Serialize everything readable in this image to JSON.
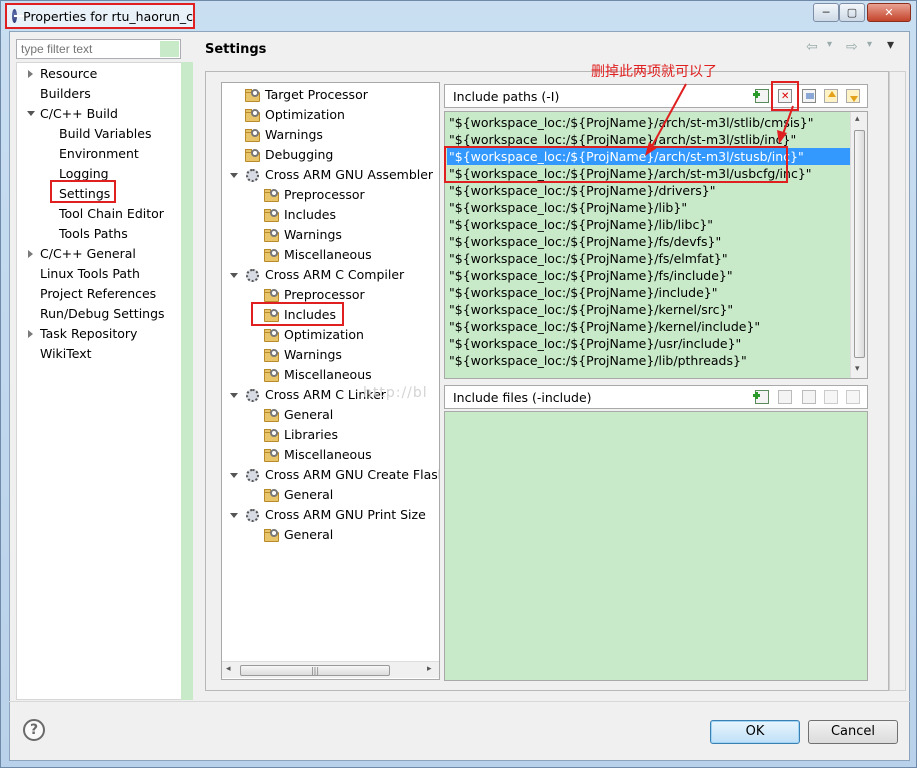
{
  "window": {
    "title": "Properties for rtu_haorun_c",
    "minimize": "─",
    "maximize": "▢",
    "close": "✕"
  },
  "sidebar": {
    "filter_placeholder": "type filter text",
    "items": [
      {
        "label": "Resource"
      },
      {
        "label": "Builders"
      },
      {
        "label": "C/C++ Build"
      },
      {
        "label": "Build Variables"
      },
      {
        "label": "Environment"
      },
      {
        "label": "Logging"
      },
      {
        "label": "Settings"
      },
      {
        "label": "Tool Chain Editor"
      },
      {
        "label": "Tools Paths"
      },
      {
        "label": "C/C++ General"
      },
      {
        "label": "Linux Tools Path"
      },
      {
        "label": "Project References"
      },
      {
        "label": "Run/Debug Settings"
      },
      {
        "label": "Task Repository"
      },
      {
        "label": "WikiText"
      }
    ]
  },
  "page": {
    "title": "Settings",
    "nav_back": "⇦",
    "nav_forward": "⇨",
    "nav_menu": "▾"
  },
  "tool_tree": [
    {
      "label": "Target Processor"
    },
    {
      "label": "Optimization"
    },
    {
      "label": "Warnings"
    },
    {
      "label": "Debugging"
    },
    {
      "label": "Cross ARM GNU Assembler"
    },
    {
      "label": "Preprocessor"
    },
    {
      "label": "Includes"
    },
    {
      "label": "Warnings"
    },
    {
      "label": "Miscellaneous"
    },
    {
      "label": "Cross ARM C Compiler"
    },
    {
      "label": "Preprocessor"
    },
    {
      "label": "Includes"
    },
    {
      "label": "Optimization"
    },
    {
      "label": "Warnings"
    },
    {
      "label": "Miscellaneous"
    },
    {
      "label": "Cross ARM C Linker"
    },
    {
      "label": "General"
    },
    {
      "label": "Libraries"
    },
    {
      "label": "Miscellaneous"
    },
    {
      "label": "Cross ARM GNU Create Flash"
    },
    {
      "label": "General"
    },
    {
      "label": "Cross ARM GNU Print Size"
    },
    {
      "label": "General"
    }
  ],
  "include_paths": {
    "header": "Include paths (-I)",
    "items": [
      "\"${workspace_loc:/${ProjName}/arch/st-m3l/stlib/cmsis}\"",
      "\"${workspace_loc:/${ProjName}/arch/st-m3l/stlib/inc}\"",
      "\"${workspace_loc:/${ProjName}/arch/st-m3l/stusb/inc}\"",
      "\"${workspace_loc:/${ProjName}/arch/st-m3l/usbcfg/inc}\"",
      "\"${workspace_loc:/${ProjName}/drivers}\"",
      "\"${workspace_loc:/${ProjName}/lib}\"",
      "\"${workspace_loc:/${ProjName}/lib/libc}\"",
      "\"${workspace_loc:/${ProjName}/fs/devfs}\"",
      "\"${workspace_loc:/${ProjName}/fs/elmfat}\"",
      "\"${workspace_loc:/${ProjName}/fs/include}\"",
      "\"${workspace_loc:/${ProjName}/include}\"",
      "\"${workspace_loc:/${ProjName}/kernel/src}\"",
      "\"${workspace_loc:/${ProjName}/kernel/include}\"",
      "\"${workspace_loc:/${ProjName}/usr/include}\"",
      "\"${workspace_loc:/${ProjName}/lib/pthreads}\""
    ]
  },
  "include_files": {
    "header": "Include files (-include)"
  },
  "annotation": {
    "text": "删掉此两项就可以了"
  },
  "watermark": "http://bl",
  "footer": {
    "help": "?",
    "ok": "OK",
    "cancel": "Cancel"
  },
  "colors": {
    "highlight_red": "#e02020",
    "list_bg": "#c8eac8",
    "selection": "#3399ff"
  }
}
